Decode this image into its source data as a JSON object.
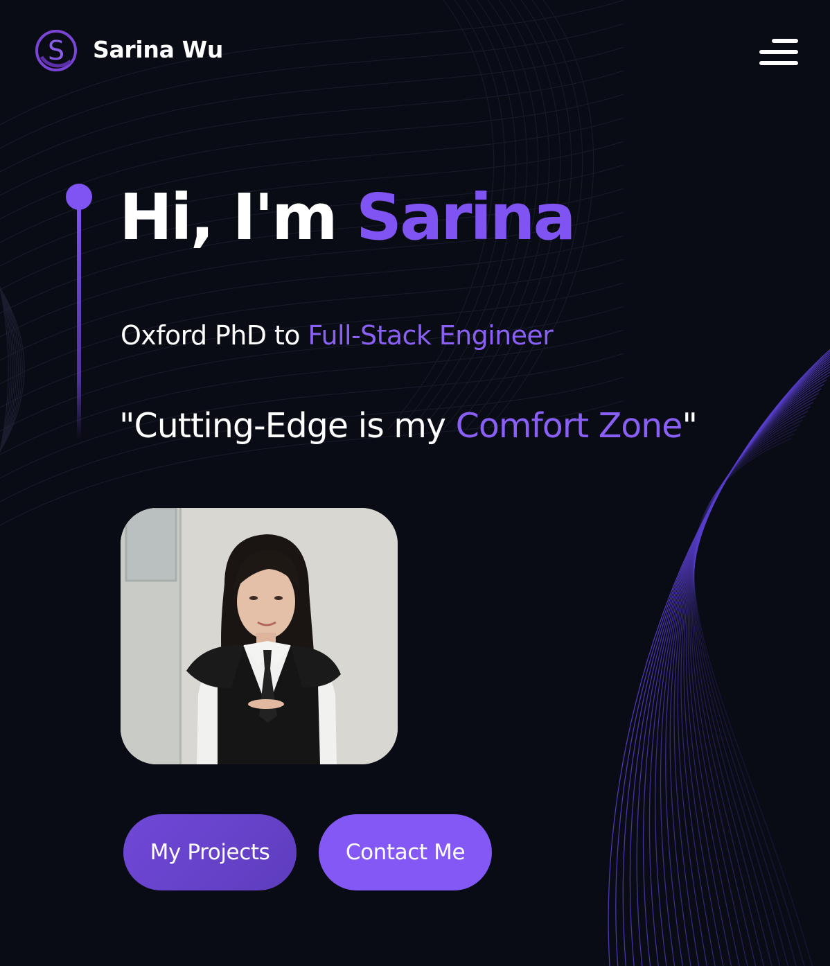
{
  "header": {
    "brand_name": "Sarina Wu",
    "logo_letter": "S",
    "logo_icon": "circle-s-logo-icon",
    "menu_icon": "hamburger-menu-icon"
  },
  "hero": {
    "greeting": "Hi, I'm ",
    "name": "Sarina",
    "subtitle_prefix": "Oxford PhD to ",
    "subtitle_accent": "Full-Stack Engineer",
    "tagline_prefix": "\"Cutting-Edge is my ",
    "tagline_accent": "Comfort Zone",
    "tagline_suffix": "\""
  },
  "buttons": {
    "projects_label": "My Projects",
    "contact_label": "Contact Me"
  },
  "colors": {
    "background": "#0a0c15",
    "accent": "#8054f2",
    "button_primary": "#6a45d0",
    "button_secondary": "#8458f5"
  }
}
